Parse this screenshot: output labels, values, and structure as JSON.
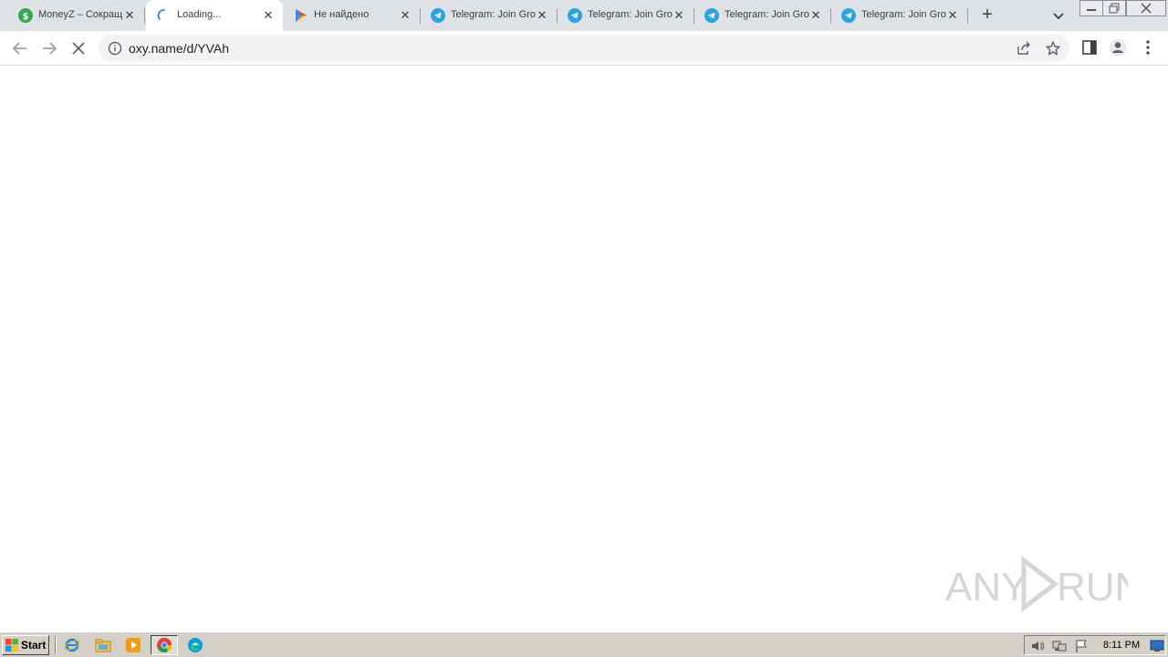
{
  "browser": {
    "tabs": [
      {
        "title": "MoneyZ – Сокращ",
        "favicon": "moneyz-icon",
        "active": false
      },
      {
        "title": "Loading...",
        "favicon": "loading-spinner-icon",
        "active": true
      },
      {
        "title": "Не найдено",
        "favicon": "google-play-icon",
        "active": false
      },
      {
        "title": "Telegram: Join Gro",
        "favicon": "telegram-icon",
        "active": false
      },
      {
        "title": "Telegram: Join Gro",
        "favicon": "telegram-icon",
        "active": false
      },
      {
        "title": "Telegram: Join Gro",
        "favicon": "telegram-icon",
        "active": false
      },
      {
        "title": "Telegram: Join Gro",
        "favicon": "telegram-icon",
        "active": false
      }
    ],
    "new_tab_label": "+",
    "url": "oxy.name/d/YVAh"
  },
  "watermark": {
    "text_left": "ANY",
    "text_right": "RUN"
  },
  "taskbar": {
    "start_label": "Start",
    "clock": "8:11 PM"
  },
  "colors": {
    "tabstrip": "#dee1e6",
    "telegram": "#2aa3df",
    "moneyz": "#34a853",
    "taskbar": "#d4d0c8"
  }
}
